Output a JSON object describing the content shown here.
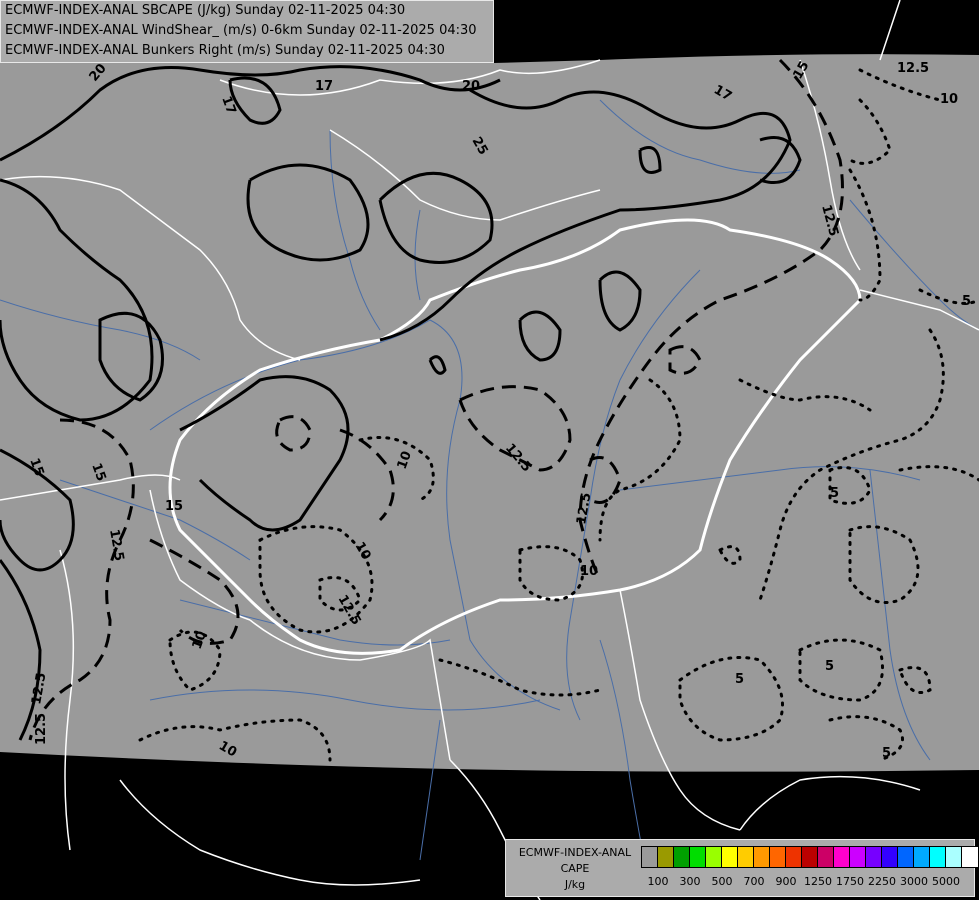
{
  "header": {
    "line1": "ECMWF-INDEX-ANAL SBCAPE (J/kg) Sunday 02-11-2025 04:30",
    "line2": "ECMWF-INDEX-ANAL WindShear_ (m/s) 0-6km Sunday 02-11-2025 04:30",
    "line3": "ECMWF-INDEX-ANAL Bunkers Right (m/s) Sunday 02-11-2025 04:30"
  },
  "map": {
    "background_color": "#9a9a9a",
    "outside_color": "#000000",
    "border_color": "#ffffff",
    "river_color": "#4a6ea8",
    "contour_color": "#000000",
    "contour_labels": [
      "20",
      "17",
      "20",
      "17",
      "25",
      "15",
      "12.5",
      "10",
      "12.5",
      "12.5",
      "17",
      "15",
      "15",
      "15",
      "12.5",
      "12.5",
      "10",
      "10",
      "12.5",
      "12.5",
      "10",
      "10",
      "10",
      "5",
      "5",
      "5",
      "5",
      "5",
      "12.5"
    ]
  },
  "legend": {
    "title_line1": "ECMWF-INDEX-ANAL",
    "title_line2": "CAPE",
    "title_line3": "J/kg",
    "swatch_colors": [
      "#9a9a9a",
      "#9a9a00",
      "#00a000",
      "#00dd00",
      "#99ff00",
      "#ffff00",
      "#ffcc00",
      "#ff9900",
      "#ff6600",
      "#ee3300",
      "#bb0000",
      "#cc0066",
      "#ff00cc",
      "#cc00ff",
      "#7700ff",
      "#3300ff",
      "#0066ff",
      "#00aaff",
      "#00ffff",
      "#aaffff",
      "#ffffff"
    ],
    "ticks": [
      "100",
      "300",
      "500",
      "700",
      "900",
      "1250",
      "1750",
      "2250",
      "3000",
      "5000"
    ]
  }
}
